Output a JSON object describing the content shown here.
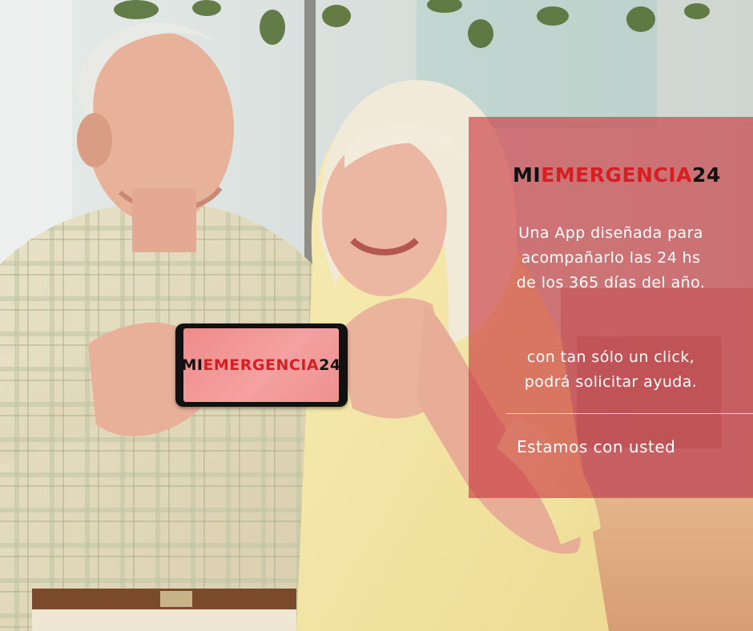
{
  "brand": {
    "mi": "MI",
    "emergencia": "EMERGENCIA",
    "num": "24",
    "color_dark": "#111111",
    "color_red": "#d61f22"
  },
  "panel": {
    "line1": "Una App diseñada para",
    "line2": "acompañarlo las 24 hs",
    "line3": "de los 365 días del año.",
    "line4": "con tan sólo un click,",
    "line5": "podrá solicitar ayuda.",
    "tagline": "Estamos con usted",
    "color": "#c8343c"
  },
  "phone": {
    "screen_color": "#f4a1a1"
  }
}
